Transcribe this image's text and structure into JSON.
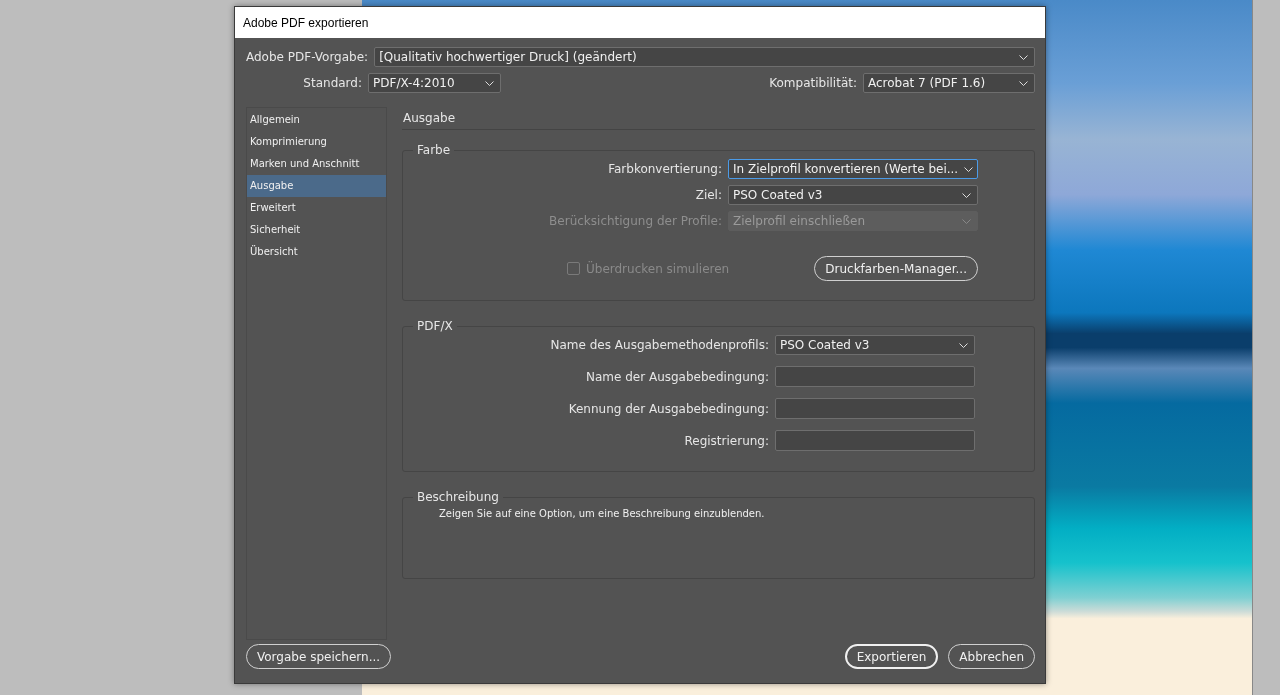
{
  "window": {
    "title": "Adobe PDF exportieren"
  },
  "preset": {
    "label": "Adobe PDF-Vorgabe:",
    "value": "[Qualitativ hochwertiger Druck] (geändert)"
  },
  "standard": {
    "label": "Standard:",
    "value": "PDF/X-4:2010"
  },
  "compatibility": {
    "label": "Kompatibilität:",
    "value": "Acrobat 7 (PDF 1.6)"
  },
  "sidebar": {
    "items": [
      {
        "label": "Allgemein",
        "selected": false
      },
      {
        "label": "Komprimierung",
        "selected": false
      },
      {
        "label": "Marken und Anschnitt",
        "selected": false
      },
      {
        "label": "Ausgabe",
        "selected": true
      },
      {
        "label": "Erweitert",
        "selected": false
      },
      {
        "label": "Sicherheit",
        "selected": false
      },
      {
        "label": "Übersicht",
        "selected": false
      }
    ]
  },
  "section_title": "Ausgabe",
  "color_group": {
    "title": "Farbe",
    "rows": [
      {
        "label": "Farbkonvertierung:",
        "value": "In Zielprofil konvertieren (Werte bei...",
        "disabled": false,
        "focused": true
      },
      {
        "label": "Ziel:",
        "value": "PSO Coated v3",
        "disabled": false,
        "focused": false
      },
      {
        "label": "Berücksichtigung der Profile:",
        "value": "Zielprofil einschließen",
        "disabled": true,
        "focused": false
      }
    ],
    "overprint": {
      "label": "Überdrucken simulieren",
      "checked": false,
      "disabled": true
    },
    "ink_manager_button": "Druckfarben-Manager..."
  },
  "pdfx_group": {
    "title": "PDF/X",
    "rows": [
      {
        "kind": "select",
        "label": "Name des Ausgabemethodenprofils:",
        "value": "PSO Coated v3"
      },
      {
        "kind": "text",
        "label": "Name der Ausgabebedingung:"
      },
      {
        "kind": "text",
        "label": "Kennung der Ausgabebedingung:"
      },
      {
        "kind": "text",
        "label": "Registrierung:"
      }
    ]
  },
  "description": {
    "title": "Beschreibung",
    "text": "Zeigen Sie auf eine Option, um eine Beschreibung einzublenden."
  },
  "buttons": {
    "save_preset": "Vorgabe speichern...",
    "export": "Exportieren",
    "cancel": "Abbrechen"
  }
}
